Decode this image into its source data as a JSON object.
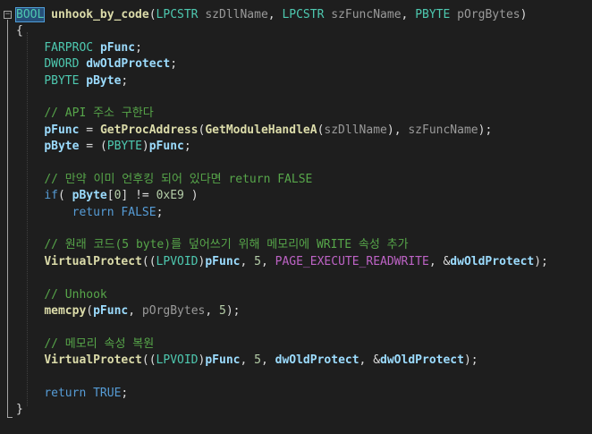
{
  "editor": {
    "lines": [
      "BOOL unhook_by_code(LPCSTR szDllName, LPCSTR szFuncName, PBYTE pOrgBytes)",
      "{",
      "    FARPROC pFunc;",
      "    DWORD dwOldProtect;",
      "    PBYTE pByte;",
      "",
      "    // API 주소 구한다",
      "    pFunc = GetProcAddress(GetModuleHandleA(szDllName), szFuncName);",
      "    pByte = (PBYTE)pFunc;",
      "",
      "    // 만약 이미 언후킹 되어 있다면 return FALSE",
      "    if( pByte[0] != 0xE9 )",
      "        return FALSE;",
      "",
      "    // 원래 코드(5 byte)를 덮어쓰기 위해 메모리에 WRITE 속성 추가",
      "    VirtualProtect((LPVOID)pFunc, 5, PAGE_EXECUTE_READWRITE, &dwOldProtect);",
      "",
      "    // Unhook",
      "    memcpy(pFunc, pOrgBytes, 5);",
      "",
      "    // 메모리 속성 복원",
      "    VirtualProtect((LPVOID)pFunc, 5, dwOldProtect, &dwOldProtect);",
      "",
      "    return TRUE;",
      "}"
    ]
  },
  "colors": {
    "background": "#1e1e1e",
    "keyword": "#569cd6",
    "type": "#4ec9b0",
    "function": "#dcdcaa",
    "parameter": "#9a9a9a",
    "local": "#9cdcfe",
    "comment": "#57a64a",
    "number": "#b5cea8",
    "macro": "#bd63c5"
  },
  "icons": {
    "fold": "minus-box-icon"
  }
}
